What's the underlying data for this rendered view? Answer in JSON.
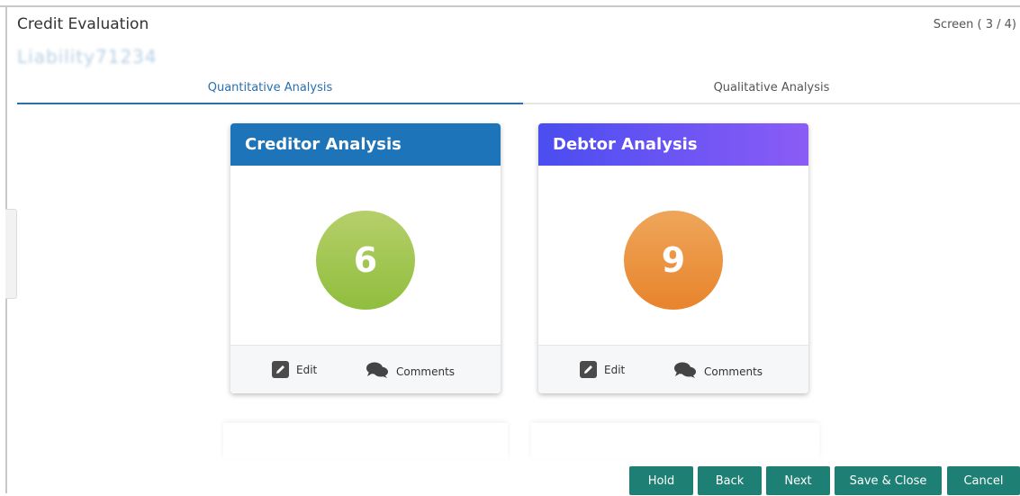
{
  "header": {
    "title": "Credit Evaluation",
    "screen_indicator": "Screen ( 3 / 4)",
    "application_id": "Liability71234"
  },
  "tabs": [
    {
      "label": "Quantitative Analysis",
      "active": true
    },
    {
      "label": "Qualitative Analysis",
      "active": false
    }
  ],
  "cards": [
    {
      "title": "Creditor Analysis",
      "count": "6",
      "edit_label": "Edit",
      "comments_label": "Comments",
      "accent": "#1e74b8",
      "circle_color": "#a3c654"
    },
    {
      "title": "Debtor Analysis",
      "count": "9",
      "edit_label": "Edit",
      "comments_label": "Comments",
      "accent": "#6a55f3",
      "circle_color": "#eb9542"
    }
  ],
  "footer": {
    "hold": "Hold",
    "back": "Back",
    "next": "Next",
    "save_close": "Save & Close",
    "cancel": "Cancel",
    "button_color": "#1e7f74"
  },
  "icons": {
    "edit": "pencil-icon",
    "comments": "comments-icon"
  }
}
